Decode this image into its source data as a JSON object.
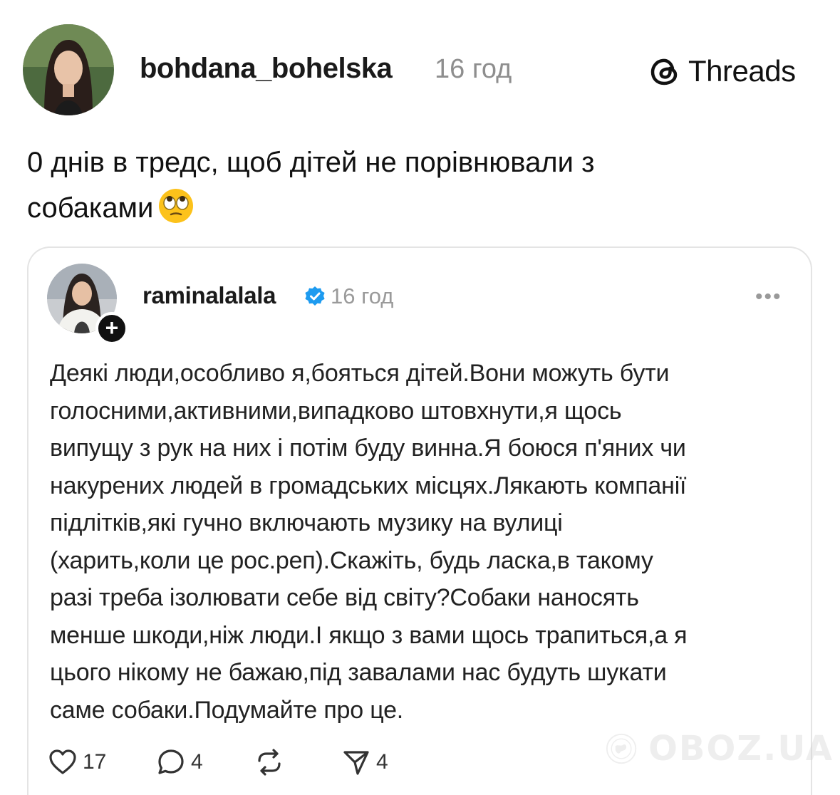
{
  "header": {
    "username": "bohdana_bohelska",
    "time": "16 год",
    "brand_label": "Threads"
  },
  "post": {
    "text": "0 днів в тредс, щоб дітей не порівнювали з\nсобаками",
    "emoji": "face-with-rolling-eyes"
  },
  "quoted": {
    "username": "raminalalala",
    "time": "16 год",
    "more": "•••",
    "text_lines": [
      "Деякі люди,особливо я,бояться дітей.Вони можуть бути",
      "голосними,активними,випадково штовхнути,я щось",
      "випущу з рук на них і потім буду винна.Я боюся п'яних чи",
      "накурених людей в громадських місцях.Лякають компанії",
      "підлітків,які гучно включають музику на вулиці",
      "(харить,коли це рос.реп).Скажіть, будь ласка,в такому",
      "разі треба ізолювати себе від світу?Собаки наносять",
      "менше шкоди,ніж люди.І якщо з вами щось трапиться,а я",
      "цього нікому не бажаю,під завалами нас будуть шукати",
      "саме собаки.Подумайте про це."
    ],
    "actions": {
      "likes": "17",
      "replies": "4",
      "reposts": "",
      "shares": "4"
    }
  },
  "watermark": {
    "text": "OBOZ.UA"
  },
  "colors": {
    "text": "#111111",
    "muted": "#8e8e8e",
    "verified": "#1d9bf0",
    "border": "#e4e4e4"
  }
}
